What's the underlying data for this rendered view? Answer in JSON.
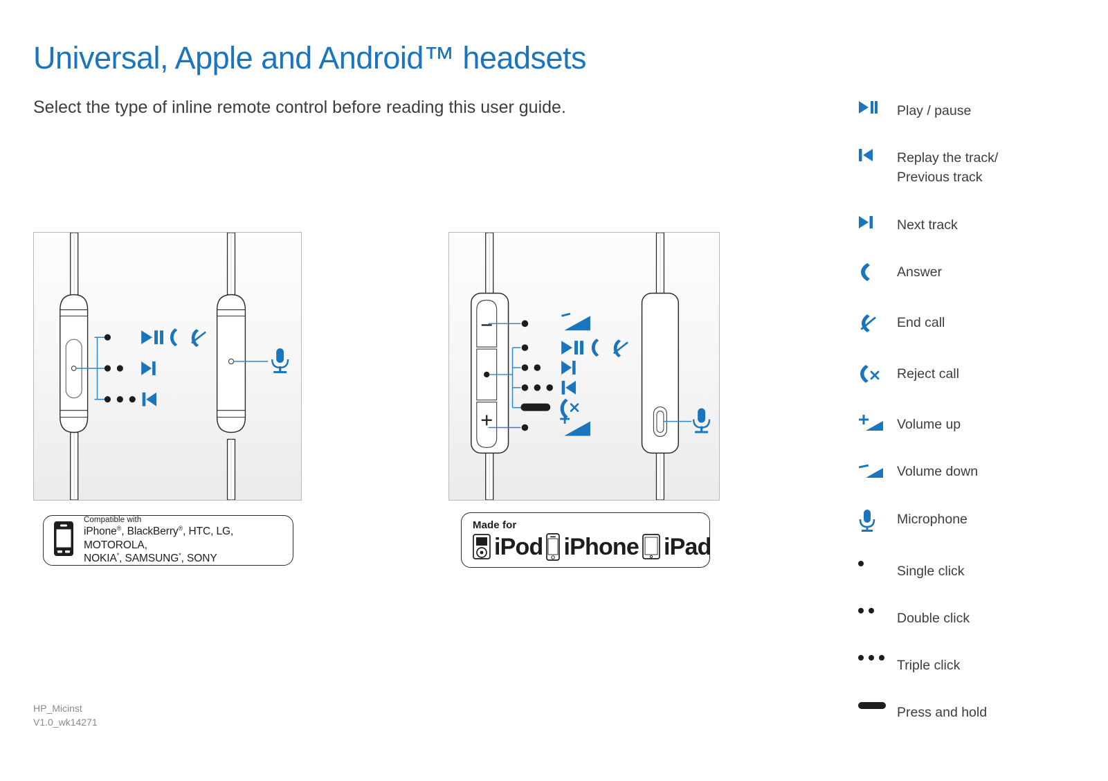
{
  "header": {
    "title": "Universal, Apple and Android™ headsets",
    "subtitle": "Select the type of inline remote control before reading this user guide."
  },
  "colors": {
    "accent_blue": "#1b75bc",
    "text_dark": "#3d3d3d",
    "ink_black": "#1d1d1d",
    "panel_border": "#b9b9b9",
    "footer_gray": "#8a8a8a"
  },
  "panels": [
    {
      "id": "universal",
      "name": "universal-remote-diagram",
      "callouts": [
        {
          "gesture": "single-click",
          "clicks": 1,
          "actions": [
            "play-pause",
            "answer",
            "end-call"
          ]
        },
        {
          "gesture": "double-click",
          "clicks": 2,
          "actions": [
            "next-track"
          ]
        },
        {
          "gesture": "triple-click",
          "clicks": 3,
          "actions": [
            "previous-track"
          ]
        },
        {
          "gesture": "microphone",
          "clicks": 0,
          "actions": [
            "microphone"
          ]
        }
      ]
    },
    {
      "id": "apple",
      "name": "apple-remote-diagram",
      "callouts": [
        {
          "gesture": "single-click",
          "clicks": 1,
          "actions": [
            "volume-down"
          ]
        },
        {
          "gesture": "single-click",
          "clicks": 1,
          "actions": [
            "play-pause",
            "answer",
            "end-call"
          ]
        },
        {
          "gesture": "double-click",
          "clicks": 2,
          "actions": [
            "next-track"
          ]
        },
        {
          "gesture": "triple-click",
          "clicks": 3,
          "actions": [
            "previous-track"
          ]
        },
        {
          "gesture": "press-and-hold",
          "clicks": 0,
          "actions": [
            "reject-call"
          ]
        },
        {
          "gesture": "single-click",
          "clicks": 1,
          "actions": [
            "volume-up"
          ]
        },
        {
          "gesture": "microphone",
          "clicks": 0,
          "actions": [
            "microphone"
          ]
        }
      ],
      "button_labels": {
        "minus": "−",
        "plus": "+"
      }
    }
  ],
  "badges": {
    "universal": {
      "icon": "mobile-phone-icon",
      "kicker": "Compatible with",
      "line1_parts": [
        {
          "text": "iPhone",
          "sup": "®"
        },
        {
          "text": ", BlackBerry",
          "sup": "®"
        },
        {
          "text": ", HTC, LG, MOTOROLA,",
          "sup": ""
        }
      ],
      "line2_parts": [
        {
          "text": "NOKIA",
          "sup": "*"
        },
        {
          "text": ", SAMSUNG",
          "sup": "*"
        },
        {
          "text": ", SONY",
          "sup": ""
        }
      ],
      "line1_plain": "iPhone®, BlackBerry®, HTC, LG, MOTOROLA,",
      "line2_plain": "NOKIA*, SAMSUNG*, SONY"
    },
    "apple": {
      "kicker": "Made for",
      "devices": [
        {
          "icon": "ipod-icon",
          "label": "iPod"
        },
        {
          "icon": "iphone-icon",
          "label": "iPhone"
        },
        {
          "icon": "ipad-icon",
          "label": "iPad"
        }
      ]
    }
  },
  "legend": {
    "items": [
      {
        "icon": "play-pause-icon",
        "label": "Play / pause"
      },
      {
        "icon": "previous-track-icon",
        "label": "Replay the track/\nPrevious track"
      },
      {
        "icon": "next-track-icon",
        "label": "Next track"
      },
      {
        "icon": "answer-call-icon",
        "label": "Answer"
      },
      {
        "icon": "end-call-icon",
        "label": "End call"
      },
      {
        "icon": "reject-call-icon",
        "label": "Reject call"
      },
      {
        "icon": "volume-up-icon",
        "label": "Volume up"
      },
      {
        "icon": "volume-down-icon",
        "label": "Volume down"
      },
      {
        "icon": "microphone-icon",
        "label": "Microphone"
      },
      {
        "icon": "single-click-icon",
        "label": "Single click"
      },
      {
        "icon": "double-click-icon",
        "label": "Double click"
      },
      {
        "icon": "triple-click-icon",
        "label": "Triple click"
      },
      {
        "icon": "press-and-hold-icon",
        "label": "Press and hold"
      }
    ]
  },
  "footer": {
    "doc_id": "HP_Micinst",
    "version": "V1.0_wk14271",
    "combined": "HP_Micinst\nV1.0_wk14271"
  }
}
